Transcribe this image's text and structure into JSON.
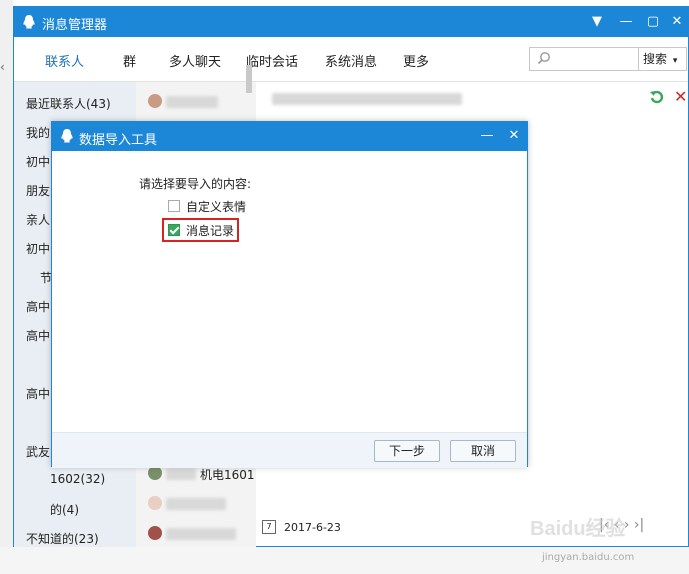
{
  "main_window": {
    "title": "消息管理器",
    "nav_tabs": [
      "联系人",
      "群",
      "多人聊天",
      "临时会话",
      "系统消息",
      "更多"
    ],
    "search_button": "搜索"
  },
  "sidebar": {
    "items": [
      "最近联系人(43)",
      "我的",
      "初中",
      "朋友",
      "亲人",
      "初中",
      "节",
      "高中",
      "高中",
      "高中",
      "武友",
      "1602(32)",
      "的(4)",
      "不知道的(23)"
    ]
  },
  "center_list": {
    "items": [
      "机电1601",
      "2017-6-23"
    ]
  },
  "dialog": {
    "title": "数据导入工具",
    "prompt": "请选择要导入的内容:",
    "options": [
      {
        "label": "自定义表情",
        "checked": false
      },
      {
        "label": "消息记录",
        "checked": true
      }
    ],
    "next_button": "下一步",
    "cancel_button": "取消"
  },
  "watermark": {
    "brand": "Baidu经验",
    "url": "jingyan.baidu.com"
  },
  "colors": {
    "titlebar": "#1c87d6",
    "highlight": "#d82323",
    "checkbox_checked": "#3aa85c"
  }
}
